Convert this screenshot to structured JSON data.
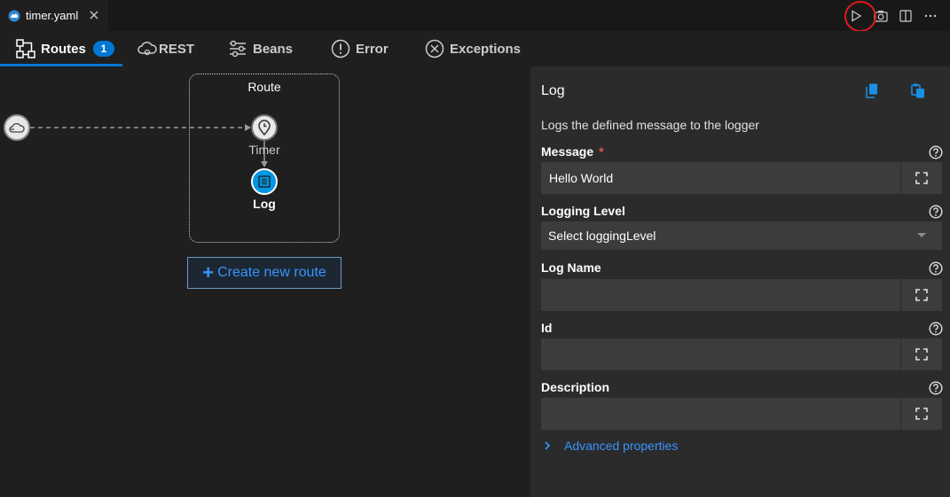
{
  "editor": {
    "file_tab_label": "timer.yaml",
    "icons": {
      "file": "camel-file-icon",
      "close": "close-icon"
    },
    "actions": [
      "run-icon",
      "camera-icon",
      "split-editor-icon",
      "more-icon"
    ],
    "highlight_color": "#e01b1b"
  },
  "view_tabs": [
    {
      "label": "Routes",
      "icon": "routes-icon",
      "badge": "1",
      "active": true
    },
    {
      "label": "REST",
      "icon": "cloud-gear-icon"
    },
    {
      "label": "Beans",
      "icon": "sliders-icon"
    },
    {
      "label": "Error",
      "icon": "alert-circle-icon"
    },
    {
      "label": "Exceptions",
      "icon": "x-circle-icon"
    }
  ],
  "canvas": {
    "route_title": "Route",
    "source_icon": "cloud-source-icon",
    "timer": {
      "label": "Timer",
      "icon": "timer-icon"
    },
    "log": {
      "label": "Log",
      "icon": "log-list-icon",
      "color": "#0096e1"
    },
    "create_route_label": "Create new route",
    "accent": "#3794ff"
  },
  "panel": {
    "title": "Log",
    "description": "Logs the defined message to the logger",
    "copy_icons": [
      "copy-icon",
      "paste-icon"
    ],
    "fields": {
      "message": {
        "label": "Message",
        "required_mark": "*",
        "value": "Hello World"
      },
      "logging_level": {
        "label": "Logging Level",
        "placeholder": "Select loggingLevel"
      },
      "log_name": {
        "label": "Log Name",
        "value": ""
      },
      "id": {
        "label": "Id",
        "value": ""
      },
      "description": {
        "label": "Description",
        "value": ""
      }
    },
    "advanced_label": "Advanced properties"
  }
}
